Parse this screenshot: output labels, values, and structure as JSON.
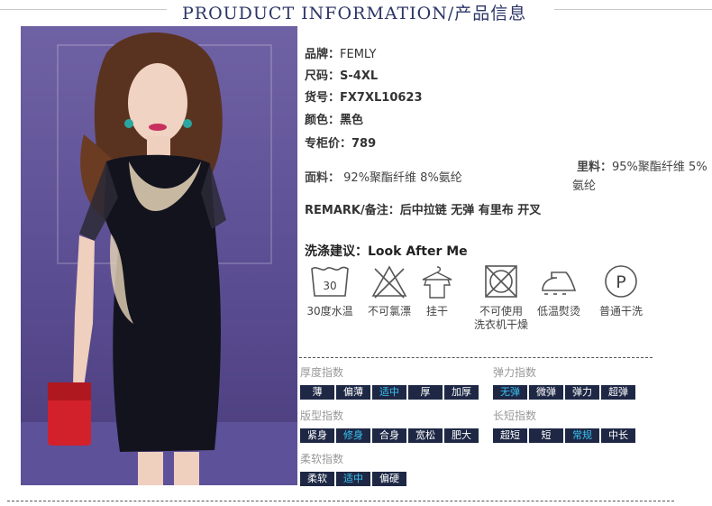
{
  "header": {
    "title": "PROUDUCT INFORMATION/产品信息"
  },
  "product": {
    "brand_label": "品牌：",
    "brand": "FEMLY",
    "size_label": "尺码：",
    "size": "S-4XL",
    "sku_label": "货号：",
    "sku": "FX7XL10623",
    "color_label": "颜色：",
    "color": "黑色",
    "price_label": "专柜价：",
    "price": "789",
    "fabric_label": "面料：",
    "fabric": "92%聚酯纤维 8%氨纶",
    "lining_label": "里料：",
    "lining_line1": "95%聚酯纤维 5%",
    "lining_line2": "氨纶",
    "remark_label": "REMARK/备注：",
    "remark": "后中拉链 无弹 有里布 开叉"
  },
  "care": {
    "label": "洗涤建议：",
    "title": "Look After Me",
    "items": [
      {
        "icon": "wash-30-icon",
        "number": "30",
        "line1": "30度水温",
        "line2": ""
      },
      {
        "icon": "no-bleach-icon",
        "line1": "不可氯漂",
        "line2": ""
      },
      {
        "icon": "hang-dry-icon",
        "line1": "挂干",
        "line2": ""
      },
      {
        "icon": "no-tumble-dry-icon",
        "line1": "不可使用",
        "line2": "洗衣机干燥"
      },
      {
        "icon": "low-iron-icon",
        "line1": "低温熨烫",
        "line2": ""
      },
      {
        "icon": "dry-clean-icon",
        "letter": "P",
        "line1": "普通干洗",
        "line2": ""
      }
    ]
  },
  "scales": {
    "thickness": {
      "title": "厚度指数",
      "options": [
        "薄",
        "偏薄",
        "适中",
        "厚",
        "加厚"
      ],
      "selected": "适中"
    },
    "elasticity": {
      "title": "弹力指数",
      "options": [
        "无弹",
        "微弹",
        "弹力",
        "超弹"
      ],
      "selected": "无弹"
    },
    "fit": {
      "title": "版型指数",
      "options": [
        "紧身",
        "修身",
        "合身",
        "宽松",
        "肥大"
      ],
      "selected": "修身"
    },
    "length": {
      "title": "长短指数",
      "options": [
        "超短",
        "短",
        "常规",
        "中长"
      ],
      "selected": "常规"
    },
    "softness": {
      "title": "柔软指数",
      "options": [
        "柔软",
        "适中",
        "偏硬"
      ],
      "selected": "适中"
    }
  },
  "colors": {
    "accent": "#39c3f2",
    "chip_bg": "#1e2845",
    "title": "#2b3566"
  }
}
